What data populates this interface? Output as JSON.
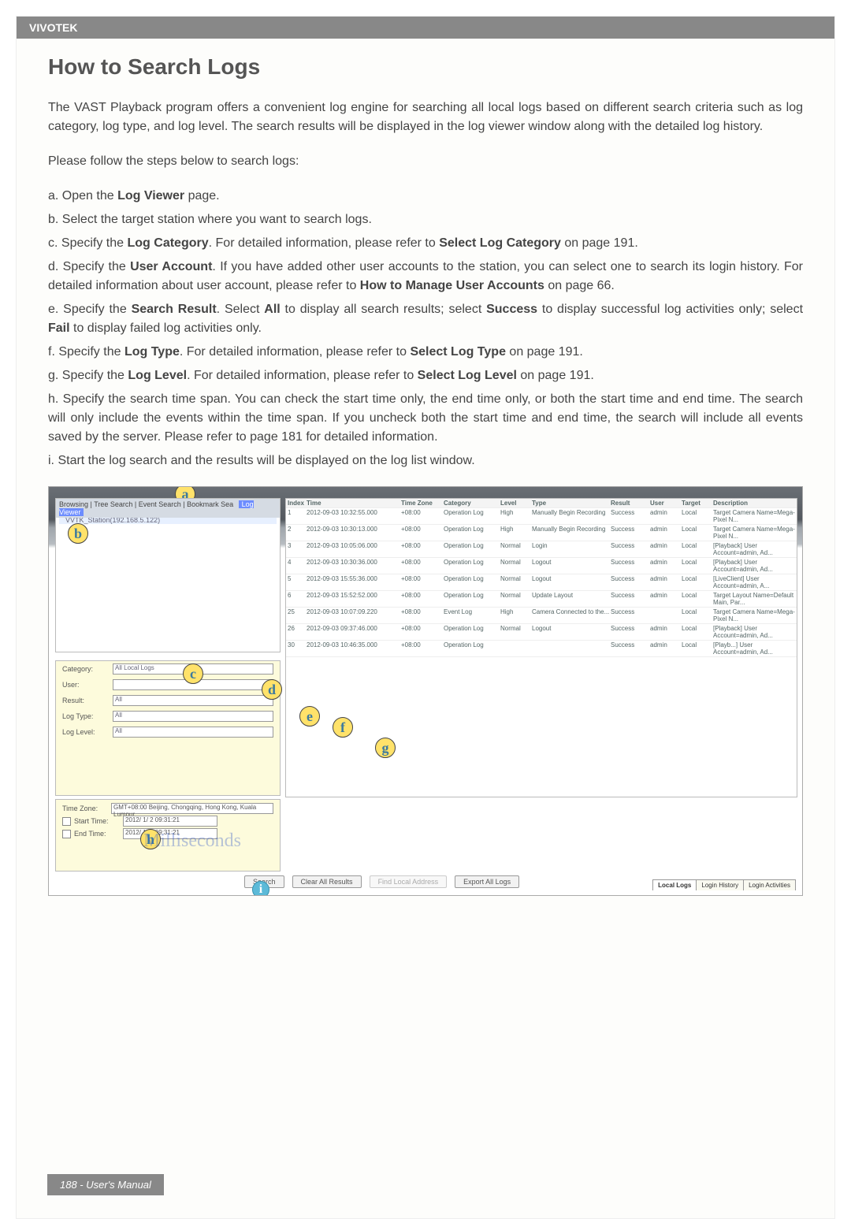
{
  "brand": "VIVOTEK",
  "title": "How to Search Logs",
  "intro": "The VAST Playback program offers a convenient log engine for searching all local logs based on different search criteria such as log category, log type, and log level. The search results will be displayed in the log viewer window along with the detailed log history.",
  "follow": "Please follow the steps below to search logs:",
  "steps": {
    "a": {
      "prefix": "a. Open the ",
      "bold": "Log Viewer",
      "suffix": " page."
    },
    "b": {
      "text": "b. Select the target station where you want to search logs."
    },
    "c": {
      "prefix": "c. Specify the ",
      "bold": "Log Category",
      "suffix": ". For detailed information, please refer to ",
      "bold2": "Select Log Category",
      "suffix2": " on page 191."
    },
    "d": {
      "prefix": "d. Specify the ",
      "bold": "User Account",
      "mid": ". If you have added other user accounts to the station, you can select one to search its login history. For detailed information about user account, please refer to ",
      "bold2": "How to Manage User Accounts",
      "suffix2": " on page 66."
    },
    "e": {
      "prefix": "e. Specify the ",
      "bold": "Search Result",
      "mid": ". Select ",
      "bold2": "All",
      "mid2": " to display all search results; select ",
      "bold3": "Success",
      "mid3": " to display successful log activities only; select ",
      "bold4": "Fail",
      "suffix": " to display failed log activities only."
    },
    "f": {
      "prefix": "f. Specify the ",
      "bold": "Log Type",
      "suffix": ". For detailed information, please refer to ",
      "bold2": "Select Log Type",
      "suffix2": " on page 191."
    },
    "g": {
      "prefix": "g. Specify the ",
      "bold": "Log Level",
      "suffix": ". For detailed information, please refer to ",
      "bold2": "Select Log Level",
      "suffix2": " on page 191."
    },
    "h": {
      "text": "h. Specify the search time span. You can check the start time only, the end time only, or both the start time and end time. The search will only include the events within the time span. If you uncheck both the start time and end time, the search will include all events saved by the server. Please refer to page 181 for detailed information."
    },
    "i": {
      "text": "i. Start the log search and the results will be displayed on the log list window."
    }
  },
  "tree": {
    "tabs": "Browsing | Tree Search | Event Search | Bookmark Sea",
    "badge": "Log Viewer",
    "root": "VVTK_Station(192.168.5.122)"
  },
  "grid": {
    "headers": {
      "idx": "Index",
      "time": "Time",
      "tz": "Time Zone",
      "cat": "Category",
      "lvl": "Level",
      "type": "Type",
      "res": "Result",
      "user": "User",
      "tgt": "Target",
      "desc": "Description"
    },
    "rows": [
      {
        "idx": "1",
        "time": "2012-09-03 10:32:55.000",
        "tz": "+08:00",
        "cat": "Operation Log",
        "lvl": "High",
        "type": "Manually Begin Recording",
        "res": "Success",
        "user": "admin",
        "tgt": "Local",
        "desc": "Target Camera Name=Mega-Pixel N..."
      },
      {
        "idx": "2",
        "time": "2012-09-03 10:30:13.000",
        "tz": "+08:00",
        "cat": "Operation Log",
        "lvl": "High",
        "type": "Manually Begin Recording",
        "res": "Success",
        "user": "admin",
        "tgt": "Local",
        "desc": "Target Camera Name=Mega-Pixel N..."
      },
      {
        "idx": "3",
        "time": "2012-09-03 10:05:06.000",
        "tz": "+08:00",
        "cat": "Operation Log",
        "lvl": "Normal",
        "type": "Login",
        "res": "Success",
        "user": "admin",
        "tgt": "Local",
        "desc": "[Playback] User Account=admin, Ad..."
      },
      {
        "idx": "4",
        "time": "2012-09-03 10:30:36.000",
        "tz": "+08:00",
        "cat": "Operation Log",
        "lvl": "Normal",
        "type": "Logout",
        "res": "Success",
        "user": "admin",
        "tgt": "Local",
        "desc": "[Playback] User Account=admin, Ad..."
      },
      {
        "idx": "5",
        "time": "2012-09-03 15:55:36.000",
        "tz": "+08:00",
        "cat": "Operation Log",
        "lvl": "Normal",
        "type": "Logout",
        "res": "Success",
        "user": "admin",
        "tgt": "Local",
        "desc": "[LiveClient] User Account=admin, A..."
      },
      {
        "idx": "6",
        "time": "2012-09-03 15:52:52.000",
        "tz": "+08:00",
        "cat": "Operation Log",
        "lvl": "Normal",
        "type": "Update Layout",
        "res": "Success",
        "user": "admin",
        "tgt": "Local",
        "desc": "Target Layout Name=Default Main, Par..."
      },
      {
        "idx": "25",
        "time": "2012-09-03 10:07:09.220",
        "tz": "+08:00",
        "cat": "Event Log",
        "lvl": "High",
        "type": "Camera Connected to the...",
        "res": "Success",
        "user": "",
        "tgt": "Local",
        "desc": "Target Camera Name=Mega-Pixel N..."
      },
      {
        "idx": "26",
        "time": "2012-09-03 09:37:46.000",
        "tz": "+08:00",
        "cat": "Operation Log",
        "lvl": "Normal",
        "type": "Logout",
        "res": "Success",
        "user": "admin",
        "tgt": "Local",
        "desc": "[Playback] User Account=admin, Ad..."
      },
      {
        "idx": "30",
        "time": "2012-09-03 10:46:35.000",
        "tz": "+08:00",
        "cat": "Operation Log",
        "lvl": "",
        "type": "",
        "res": "Success",
        "user": "admin",
        "tgt": "Local",
        "desc": "[Playb...] User Account=admin, Ad..."
      }
    ]
  },
  "filters": {
    "category": {
      "label": "Category:",
      "value": "All Local Logs"
    },
    "user": {
      "label": "User:",
      "value": ""
    },
    "result": {
      "label": "Result:",
      "value": "All"
    },
    "type": {
      "label": "Log Type:",
      "value": "All"
    },
    "level": {
      "label": "Log Level:",
      "value": "All"
    }
  },
  "time": {
    "zone_label": "Time Zone:",
    "zone_value": "GMT+08:00 Beijing, Chongqing, Hong Kong, Kuala Lumpur,",
    "start_label": "Start Time:",
    "start_value": "2012/ 1/ 2   09:31:21",
    "end_label": "End Time:",
    "end_value": "2012/ 1/ 2   09:31:21",
    "watermark": "Milliseconds"
  },
  "buttons": {
    "search": "Search",
    "clear": "Clear All Results",
    "find": "Find Local Address",
    "export": "Export All Logs"
  },
  "bottom_tabs": {
    "t1": "Local Logs",
    "t2": "Login History",
    "t3": "Login Activities"
  },
  "callouts": {
    "a": "a",
    "b": "b",
    "c": "c",
    "d": "d",
    "e": "e",
    "f": "f",
    "g": "g",
    "h": "h",
    "i": "i",
    "info": "i"
  },
  "footer": "188 - User's Manual"
}
